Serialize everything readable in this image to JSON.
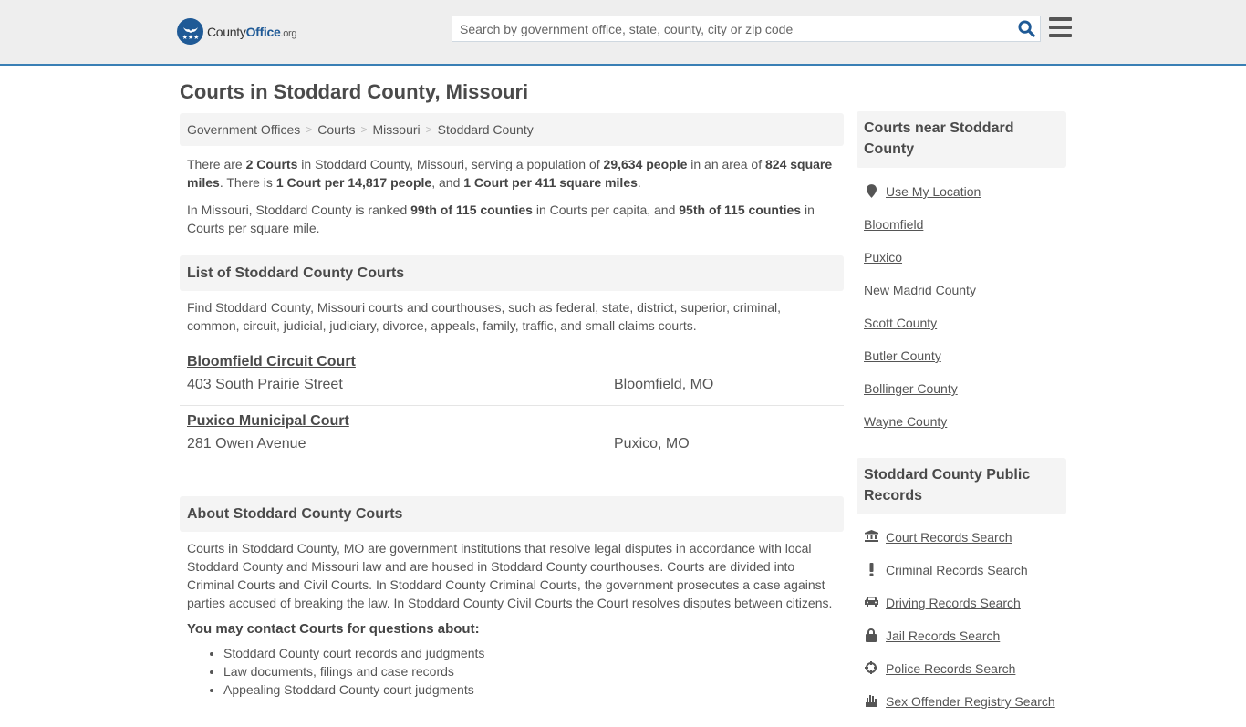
{
  "header": {
    "logo": {
      "brand_prefix": "County",
      "brand_main": "Office",
      "brand_suffix": ".org"
    },
    "search": {
      "placeholder": "Search by government office, state, county, city or zip code",
      "value": ""
    },
    "menu_icon": "hamburger-icon",
    "search_icon": "magnifier-icon",
    "accent_color": "#3a7fb5"
  },
  "page": {
    "title": "Courts in Stoddard County, Missouri"
  },
  "breadcrumb": [
    "Government Offices",
    "Courts",
    "Missouri",
    "Stoddard County"
  ],
  "summary": {
    "p1": [
      {
        "t": "There are ",
        "b": false
      },
      {
        "t": "2 Courts",
        "b": true
      },
      {
        "t": " in Stoddard County, Missouri, serving a population of ",
        "b": false
      },
      {
        "t": "29,634 people",
        "b": true
      },
      {
        "t": " in an area of ",
        "b": false
      },
      {
        "t": "824 square miles",
        "b": true
      },
      {
        "t": ". There is ",
        "b": false
      },
      {
        "t": "1 Court per 14,817 people",
        "b": true
      },
      {
        "t": ", and ",
        "b": false
      },
      {
        "t": "1 Court per 411 square miles",
        "b": true
      },
      {
        "t": ".",
        "b": false
      }
    ],
    "p2": [
      {
        "t": "In Missouri, Stoddard County is ranked ",
        "b": false
      },
      {
        "t": "99th of 115 counties",
        "b": true
      },
      {
        "t": " in Courts per capita, and ",
        "b": false
      },
      {
        "t": "95th of 115 counties",
        "b": true
      },
      {
        "t": " in Courts per square mile.",
        "b": false
      }
    ]
  },
  "list_section": {
    "heading": "List of Stoddard County Courts",
    "description": "Find Stoddard County, Missouri courts and courthouses, such as federal, state, district, superior, criminal, common, circuit, judicial, judiciary, divorce, appeals, family, traffic, and small claims courts.",
    "courts": [
      {
        "name": "Bloomfield Circuit Court",
        "address": "403 South Prairie Street",
        "city": "Bloomfield, MO"
      },
      {
        "name": "Puxico Municipal Court",
        "address": "281 Owen Avenue",
        "city": "Puxico, MO"
      }
    ]
  },
  "about_section": {
    "heading": "About Stoddard County Courts",
    "body": "Courts in Stoddard County, MO are government institutions that resolve legal disputes in accordance with local Stoddard County and Missouri law and are housed in Stoddard County courthouses. Courts are divided into Criminal Courts and Civil Courts. In Stoddard County Criminal Courts, the government prosecutes a case against parties accused of breaking the law. In Stoddard County Civil Courts the Court resolves disputes between citizens.",
    "contact_heading": "You may contact Courts for questions about:",
    "contact_items": [
      "Stoddard County court records and judgments",
      "Law documents, filings and case records",
      "Appealing Stoddard County court judgments"
    ]
  },
  "sidebar": {
    "nearby": {
      "heading": "Courts near Stoddard County",
      "use_location": {
        "label": "Use My Location",
        "icon": "map-marker-icon"
      },
      "links": [
        "Bloomfield",
        "Puxico",
        "New Madrid County",
        "Scott County",
        "Butler County",
        "Bollinger County",
        "Wayne County"
      ]
    },
    "records": {
      "heading": "Stoddard County Public Records",
      "links": [
        {
          "label": "Court Records Search",
          "icon": "courthouse-icon"
        },
        {
          "label": "Criminal Records Search",
          "icon": "exclamation-icon"
        },
        {
          "label": "Driving Records Search",
          "icon": "car-icon"
        },
        {
          "label": "Jail Records Search",
          "icon": "lock-icon"
        },
        {
          "label": "Police Records Search",
          "icon": "crosshairs-icon"
        },
        {
          "label": "Sex Offender Registry Search",
          "icon": "hand-icon"
        }
      ]
    }
  }
}
